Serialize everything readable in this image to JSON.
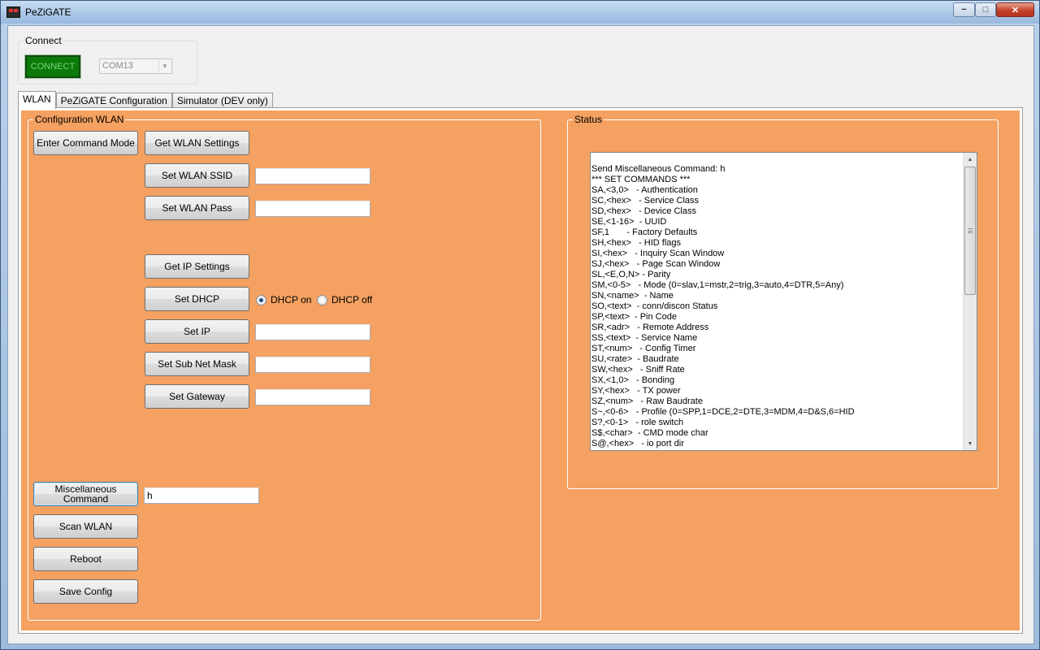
{
  "window": {
    "title": "PeZiGATE",
    "controls": {
      "minimize": "−",
      "maximize": "□",
      "close": "✕"
    }
  },
  "connect": {
    "group_title": "Connect",
    "button_label": "CONNECT",
    "port_value": "COM13",
    "button_color": "#0b7a0b"
  },
  "tabs": [
    {
      "label": "WLAN",
      "active": true
    },
    {
      "label": "PeZiGATE Configuration",
      "active": false
    },
    {
      "label": "Simulator (DEV only)",
      "active": false
    }
  ],
  "config": {
    "group_title": "Configuration WLAN",
    "enter_command_mode": "Enter Command Mode",
    "get_wlan_settings": "Get WLAN Settings",
    "set_wlan_ssid": "Set WLAN SSID",
    "ssid_value": "",
    "set_wlan_pass": "Set WLAN Pass",
    "pass_value": "",
    "get_ip_settings": "Get IP Settings",
    "set_dhcp": "Set DHCP",
    "dhcp_on": "DHCP on",
    "dhcp_off": "DHCP off",
    "dhcp_selected": "on",
    "set_ip": "Set IP",
    "ip_value": "",
    "set_subnet": "Set Sub Net Mask",
    "subnet_value": "",
    "set_gateway": "Set Gateway",
    "gateway_value": "",
    "misc_command": "Miscellaneous Command",
    "misc_value": "h",
    "scan_wlan": "Scan WLAN",
    "reboot": "Reboot",
    "save_config": "Save Config"
  },
  "status": {
    "group_title": "Status",
    "lines": [
      "Send Miscellaneous Command: h",
      "*** SET COMMANDS ***",
      "SA,<3,0>   - Authentication",
      "SC,<hex>   - Service Class",
      "SD,<hex>   - Device Class",
      "SE,<1-16>  - UUID",
      "SF,1       - Factory Defaults",
      "SH,<hex>   - HID flags",
      "SI,<hex>   - Inquiry Scan Window",
      "SJ,<hex>   - Page Scan Window",
      "SL,<E,O,N> - Parity",
      "SM,<0-5>   - Mode (0=slav,1=mstr,2=trig,3=auto,4=DTR,5=Any)",
      "SN,<name>  - Name",
      "SO,<text>  - conn/discon Status",
      "SP,<text>  - Pin Code",
      "SR,<adr>   - Remote Address",
      "SS,<text>  - Service Name",
      "ST,<num>   - Config Timer",
      "SU,<rate>  - Baudrate",
      "SW,<hex>   - Sniff Rate",
      "SX,<1,0>   - Bonding",
      "SY,<hex>   - TX power",
      "SZ,<num>   - Raw Baudrate",
      "S~,<0-6>   - Profile (0=SPP,1=DCE,2=DTE,3=MDM,4=D&S,6=HID",
      "S?,<0-1>   - role switch",
      "S$,<char>  - CMD mode char",
      "S@,<hex>   - io port dir"
    ]
  },
  "colors": {
    "panel_background": "#f4a161",
    "connect_active": "#0b7a0b"
  }
}
